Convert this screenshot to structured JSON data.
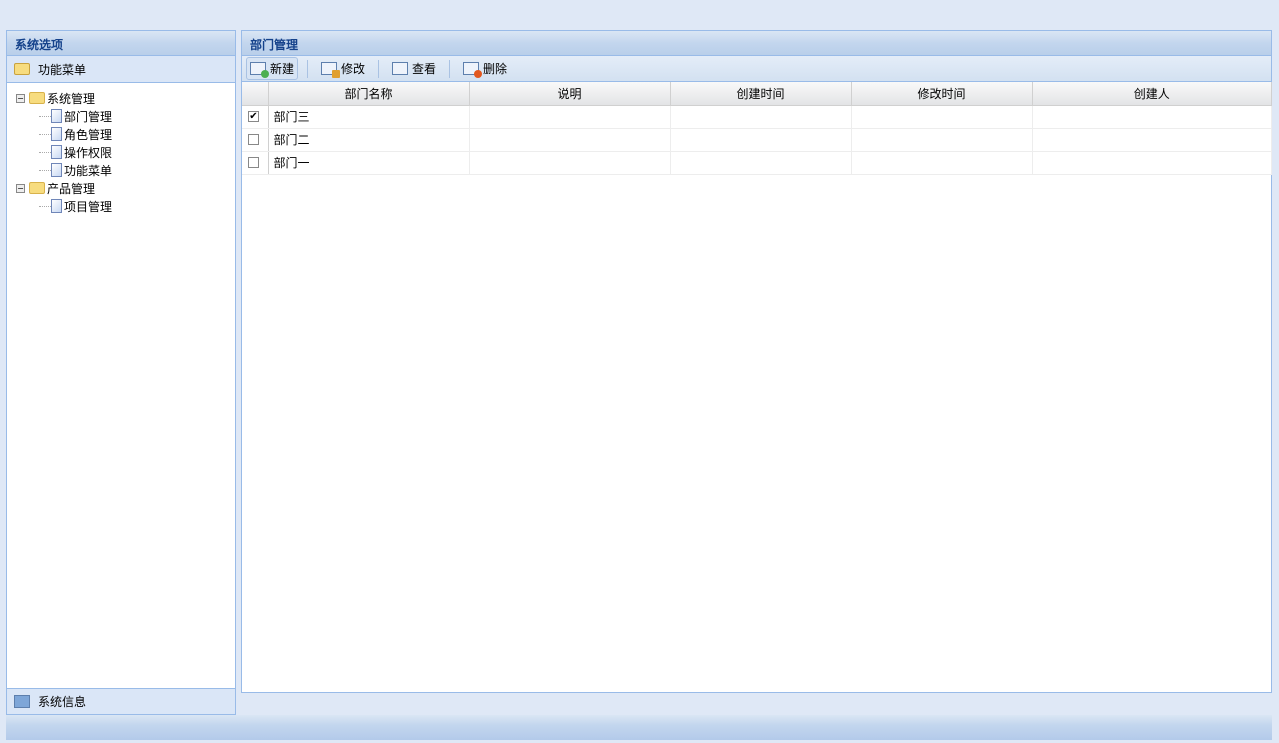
{
  "left": {
    "title": "系统选项",
    "accordion_top": "功能菜单",
    "accordion_bottom": "系统信息",
    "tree": [
      {
        "label": "系统管理",
        "children": [
          "部门管理",
          "角色管理",
          "操作权限",
          "功能菜单"
        ]
      },
      {
        "label": "产品管理",
        "children": [
          "项目管理"
        ]
      }
    ]
  },
  "right": {
    "title": "部门管理",
    "toolbar": {
      "new": "新建",
      "edit": "修改",
      "view": "查看",
      "delete": "删除"
    },
    "columns": [
      "部门名称",
      "说明",
      "创建时间",
      "修改时间",
      "创建人"
    ],
    "rows": [
      {
        "name": "部门三",
        "checked": true
      },
      {
        "name": "部门二",
        "checked": false
      },
      {
        "name": "部门一",
        "checked": false
      }
    ]
  }
}
